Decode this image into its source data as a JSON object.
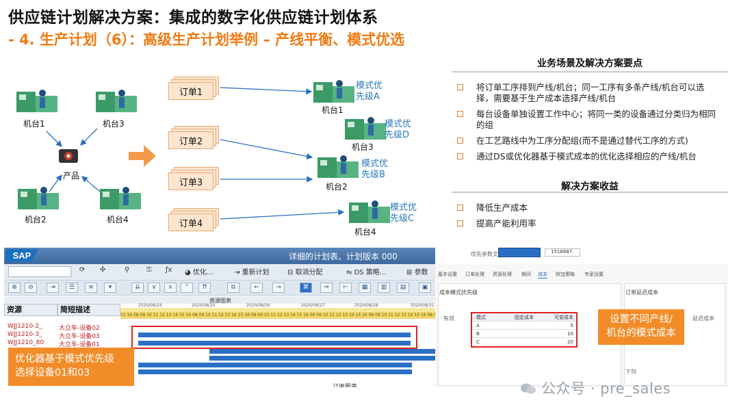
{
  "header": {
    "title": "供应链计划解决方案：集成的数字化供应链计划体系",
    "subtitle": "- 4. 生产计划（6）：高级生产计划举例 – 产线平衡、模式优选"
  },
  "diagram": {
    "left_machines": [
      "机台1",
      "机台3",
      "机台2",
      "机台4"
    ],
    "product_label": "产品",
    "orders": [
      "订单1",
      "订单2",
      "订单3",
      "订单4"
    ],
    "targets": [
      {
        "machine": "机台1",
        "priority_line1": "模式优",
        "priority_line2": "先级A"
      },
      {
        "machine": "机台3",
        "priority_line1": "模式优",
        "priority_line2": "先级D"
      },
      {
        "machine": "机台2",
        "priority_line1": "模式优",
        "priority_line2": "先级B"
      },
      {
        "machine": "机台4",
        "priority_line1": "模式优",
        "priority_line2": "先级C"
      }
    ]
  },
  "panel": {
    "heading": "业务场景及解决方案要点",
    "points": [
      "将订单工序排到产线/机台；同一工序有多条产线/机台可以选择，需要基于生产成本选择产线/机台",
      "每台设备单独设置工作中心；将同一类的设备通过分类归为相同的组",
      "在工艺路线中为工序分配组(而不是通过替代工序的方式)",
      "通过DS或优化器基于模式成本的优化选择相应的产线/机台"
    ],
    "benefits_heading": "解决方案收益",
    "benefits": [
      "降低生产成本",
      "提高产能利用率"
    ]
  },
  "sap": {
    "logo": "SAP",
    "window_title": "详细的计划表、计划版本 000",
    "toolbar": {
      "optimize": "优化...",
      "reschedule": "重新计划",
      "cancel_assign": "取消分配",
      "ds_strategy": "DS 策略...",
      "params": "参数"
    },
    "gantt": {
      "chart_title": "资源图表",
      "col_resource": "资源",
      "col_desc": "简短描述",
      "dates": [
        "2020/08/24",
        "2020/08/25",
        "2020/08/26",
        "2020/08/27",
        "2020/08/28",
        "2020/08/31"
      ],
      "hours": "15 16 08 09 10 11 12 13 14 15 16 08 09 10 11 12 13 14 15 16 08 09 10 11 12 13 14 15 16 08 09 10 11 12 13 14 15 16 08 09 10 11 12 13 14 15 16 08 09 10 11 12",
      "rows": [
        {
          "resource": "WJJ1210-2_",
          "desc": "大立车-设备02"
        },
        {
          "resource": "WJJ1210-3_",
          "desc": "大立车-设备03"
        },
        {
          "resource": "WJJ1210_80",
          "desc": "大立车-设备01"
        }
      ],
      "bottom_title": "订单图表"
    }
  },
  "sap2": {
    "field_label": "优先参数文件:",
    "field_value": "1516687",
    "tabs": [
      "基本设置",
      "订单处理",
      "资源处理",
      "期间",
      "成本",
      "附加策略",
      "专家设置"
    ],
    "section_left": "成本模式优先级",
    "section_right": "订单延迟成本",
    "table_headers": [
      "模式",
      "固定成本",
      "可变成本"
    ],
    "table_rows": [
      {
        "mode": "A",
        "cost": "5"
      },
      {
        "mode": "B",
        "cost": "10"
      },
      {
        "mode": "C",
        "cost": "20"
      }
    ],
    "side_label": "有效",
    "right_label": "延迟成本",
    "down_label": "下列"
  },
  "callouts": {
    "left_line1": "优化器基于模式优先级",
    "left_line2": "选择设备01和03",
    "right_line1": "设置不同产线/",
    "right_line2": "机台的模式成本"
  },
  "watermark": "公众号 · pre_sales",
  "colors": {
    "accent": "#f07a13",
    "link_blue": "#2a78b8",
    "sap_blue": "#2b6fc4",
    "highlight_red": "#e02020"
  }
}
